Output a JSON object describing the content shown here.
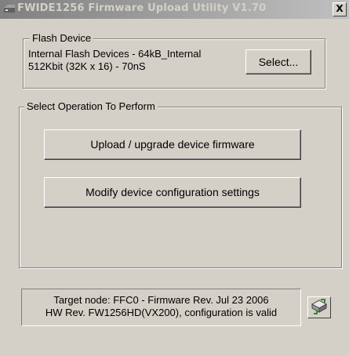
{
  "window": {
    "title": "FWIDE1256 Firmware Upload Utility V1.70",
    "close_label": "X"
  },
  "flash_device": {
    "group_label": "Flash Device",
    "device_line1": "Internal Flash Devices - 64kB_Internal",
    "device_line2": "512Kbit (32K x 16) - 70nS",
    "select_label": "Select..."
  },
  "operation": {
    "group_label": "Select Operation To Perform",
    "upload_label": "Upload / upgrade device firmware",
    "modify_label": "Modify device configuration settings"
  },
  "status": {
    "line1": "Target node: FFC0 - Firmware Rev. Jul 23 2006",
    "line2": "HW Rev. FW1256HD(VX200), configuration is valid"
  },
  "icons": {
    "title_icon": "app-icon",
    "status_icon": "device-icon"
  },
  "colors": {
    "face": "#d4d0c8",
    "title_gradient_start": "#808080",
    "title_gradient_end": "#c0c0c0",
    "icon_green": "#2e8b2e"
  }
}
